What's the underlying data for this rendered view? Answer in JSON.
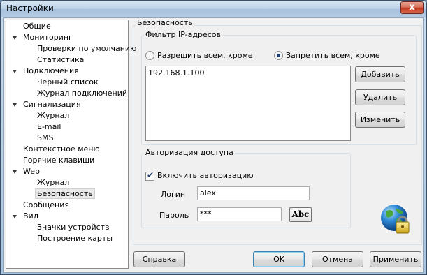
{
  "window": {
    "title": "Настройки",
    "close_glyph": "x"
  },
  "tree": {
    "items": [
      {
        "label": "Общие"
      },
      {
        "label": "Мониторинг"
      },
      {
        "label": "Проверки по умолчанию"
      },
      {
        "label": "Статистика"
      },
      {
        "label": "Подключения"
      },
      {
        "label": "Черный список"
      },
      {
        "label": "Журнал подключений"
      },
      {
        "label": "Сигнализация"
      },
      {
        "label": "Журнал"
      },
      {
        "label": "E-mail"
      },
      {
        "label": "SMS"
      },
      {
        "label": "Контекстное меню"
      },
      {
        "label": "Горячие клавиши"
      },
      {
        "label": "Web"
      },
      {
        "label": "Журнал"
      },
      {
        "label": "Безопасность"
      },
      {
        "label": "Сообщения"
      },
      {
        "label": "Вид"
      },
      {
        "label": "Значки устройств"
      },
      {
        "label": "Построение карты"
      }
    ],
    "selected": "Безопасность"
  },
  "security": {
    "title": "Безопасность",
    "ip_filter": {
      "label": "Фильтр IP-адресов",
      "allow_label": "Разрешить всем, кроме",
      "deny_label": "Запретить всем, кроме",
      "selected_mode": "deny",
      "addresses": [
        "192.168.1.100"
      ],
      "add_label": "Добавить",
      "remove_label": "Удалить",
      "edit_label": "Изменить"
    },
    "auth": {
      "label": "Авторизация доступа",
      "enable_label": "Включить авторизацию",
      "enabled": true,
      "login_label": "Логин",
      "login_value": "alex",
      "password_label": "Пароль",
      "password_value": "***",
      "abc_label": "Abc"
    },
    "badge_icon": "globe-lock-icon"
  },
  "footer": {
    "help_label": "Справка",
    "ok_label": "OK",
    "cancel_label": "Отмена",
    "apply_label": "Применить"
  }
}
